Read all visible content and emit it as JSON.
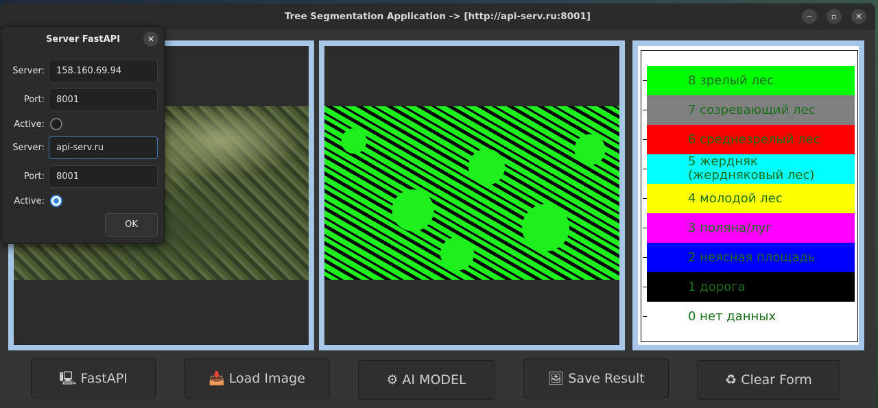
{
  "window": {
    "title": "Tree Segmentation Application -> [http://api-serv.ru:8001]",
    "minimize": "‒",
    "maximize": "▫",
    "close": "✕"
  },
  "legend": {
    "colors": [
      "#00ff00",
      "#808080",
      "#ff0000",
      "#00ffff",
      "#ffff00",
      "#ff00ff",
      "#0000ff",
      "#000000",
      "#ffffff"
    ],
    "items": [
      "8 зрелый лес",
      "7 созревающий лес",
      "6 среднезрелый лес",
      "5 жердняк",
      "(жердняковый лес)",
      "4 молодой лес",
      "3 поляна/луг",
      "2 неясная площадь",
      "1 дорога",
      "0 нет данных"
    ]
  },
  "buttons": {
    "fastapi": {
      "icon": "🖳",
      "label": "FastAPI"
    },
    "load": {
      "icon": "📥",
      "label": "Load Image"
    },
    "model": {
      "icon": "⚙",
      "label": "AI MODEL"
    },
    "save": {
      "icon": "🖼",
      "label": "Save Result"
    },
    "clear": {
      "icon": "♻",
      "label": "Clear Form"
    }
  },
  "dialog": {
    "title": "Server FastAPI",
    "close": "✕",
    "server_label": "Server:",
    "port_label": "Port:",
    "active_label": "Active:",
    "server1": "158.160.69.94",
    "port1": "8001",
    "active1": false,
    "server2": "api-serv.ru",
    "port2": "8001",
    "active2": true,
    "ok": "OK"
  }
}
